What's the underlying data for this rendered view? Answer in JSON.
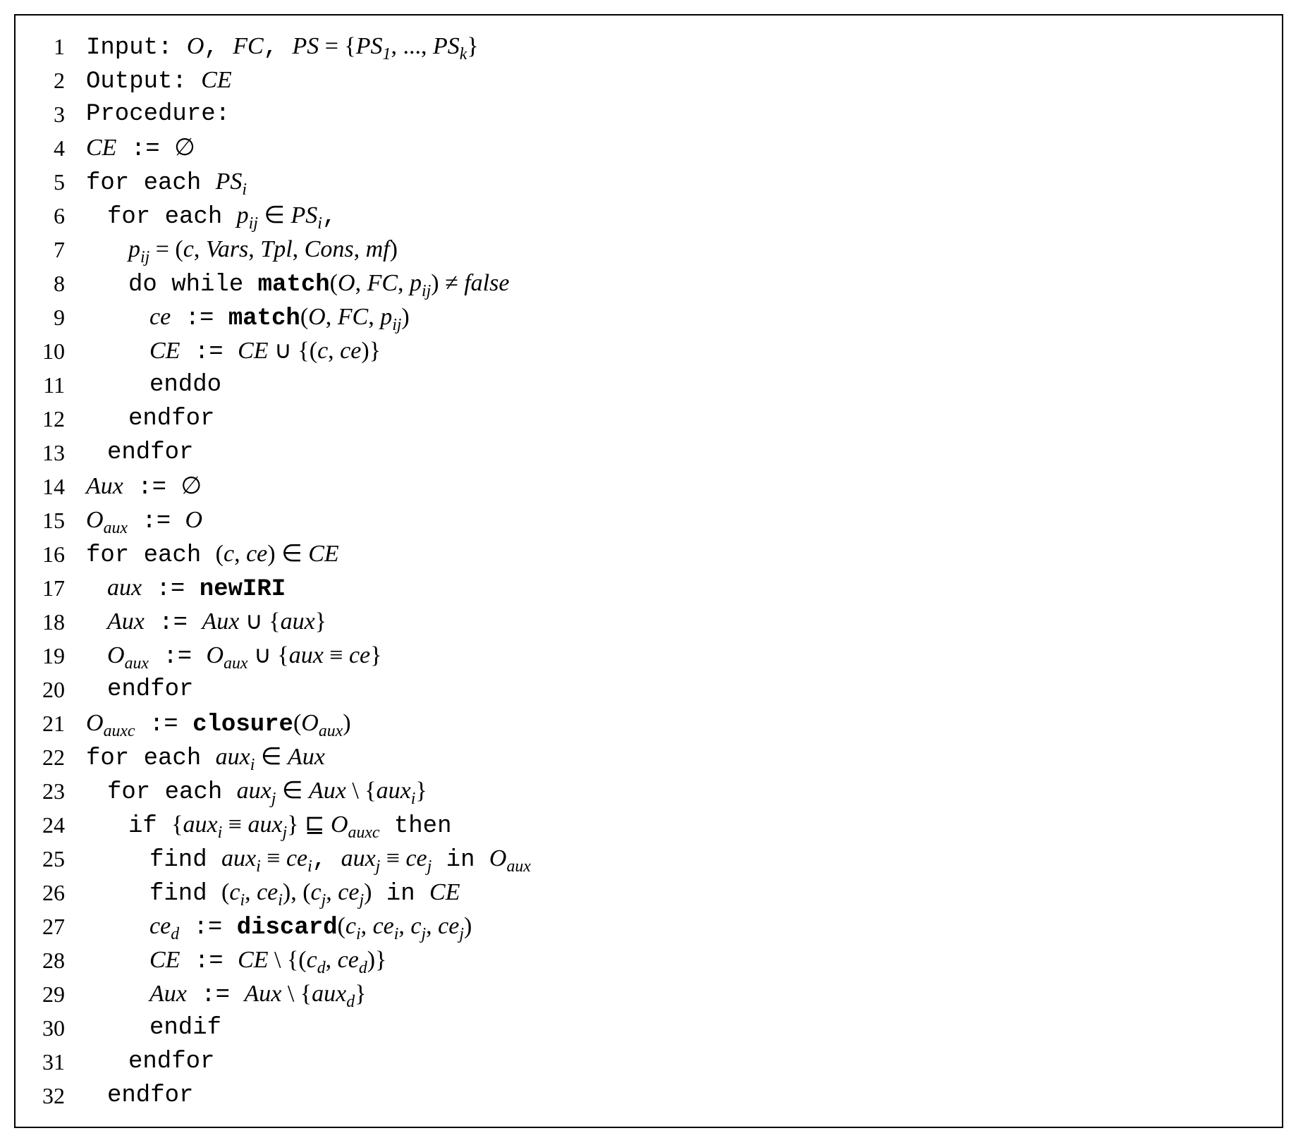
{
  "algorithm": {
    "lines": [
      {
        "n": "1",
        "indent": 0,
        "segs": [
          {
            "c": "tt",
            "t": "Input: "
          },
          {
            "c": "it",
            "t": "O"
          },
          {
            "c": "tt",
            "t": ", "
          },
          {
            "c": "it",
            "t": "FC"
          },
          {
            "c": "tt",
            "t": ", "
          },
          {
            "c": "it",
            "t": "PS"
          },
          {
            "c": "sym",
            "t": " = {"
          },
          {
            "c": "it",
            "t": "PS"
          },
          {
            "c": "sub",
            "t": "1"
          },
          {
            "c": "sym",
            "t": ", ..., "
          },
          {
            "c": "it",
            "t": "PS"
          },
          {
            "c": "sub",
            "t": "k"
          },
          {
            "c": "sym",
            "t": "}"
          }
        ]
      },
      {
        "n": "2",
        "indent": 0,
        "segs": [
          {
            "c": "tt",
            "t": "Output: "
          },
          {
            "c": "it",
            "t": "CE"
          }
        ]
      },
      {
        "n": "3",
        "indent": 0,
        "segs": [
          {
            "c": "tt",
            "t": "Procedure:"
          }
        ]
      },
      {
        "n": "4",
        "indent": 0,
        "segs": [
          {
            "c": "it",
            "t": "CE"
          },
          {
            "c": "tt",
            "t": " := "
          },
          {
            "c": "sym",
            "t": "∅"
          }
        ]
      },
      {
        "n": "5",
        "indent": 0,
        "segs": [
          {
            "c": "tt",
            "t": "for each "
          },
          {
            "c": "it",
            "t": "PS"
          },
          {
            "c": "sub",
            "t": "i"
          }
        ]
      },
      {
        "n": "6",
        "indent": 1,
        "segs": [
          {
            "c": "tt",
            "t": "for each "
          },
          {
            "c": "it",
            "t": "p"
          },
          {
            "c": "sub",
            "t": "ij"
          },
          {
            "c": "sym",
            "t": " ∈ "
          },
          {
            "c": "it",
            "t": "PS"
          },
          {
            "c": "sub",
            "t": "i"
          },
          {
            "c": "tt",
            "t": ","
          }
        ]
      },
      {
        "n": "7",
        "indent": 2,
        "segs": [
          {
            "c": "it",
            "t": "p"
          },
          {
            "c": "sub",
            "t": "ij"
          },
          {
            "c": "sym",
            "t": " = ("
          },
          {
            "c": "it",
            "t": "c"
          },
          {
            "c": "sym",
            "t": ", "
          },
          {
            "c": "it",
            "t": "Vars"
          },
          {
            "c": "sym",
            "t": ", "
          },
          {
            "c": "it",
            "t": "Tpl"
          },
          {
            "c": "sym",
            "t": ", "
          },
          {
            "c": "it",
            "t": "Cons"
          },
          {
            "c": "sym",
            "t": ", "
          },
          {
            "c": "it",
            "t": "mf"
          },
          {
            "c": "sym",
            "t": ")"
          }
        ]
      },
      {
        "n": "8",
        "indent": 2,
        "segs": [
          {
            "c": "tt",
            "t": "do while "
          },
          {
            "c": "bf",
            "t": "match"
          },
          {
            "c": "sym",
            "t": "("
          },
          {
            "c": "it",
            "t": "O"
          },
          {
            "c": "sym",
            "t": ", "
          },
          {
            "c": "it",
            "t": "FC"
          },
          {
            "c": "sym",
            "t": ", "
          },
          {
            "c": "it",
            "t": "p"
          },
          {
            "c": "sub",
            "t": "ij"
          },
          {
            "c": "sym",
            "t": ") ≠ "
          },
          {
            "c": "it",
            "t": "false"
          }
        ]
      },
      {
        "n": "9",
        "indent": 3,
        "segs": [
          {
            "c": "it",
            "t": "ce"
          },
          {
            "c": "tt",
            "t": " := "
          },
          {
            "c": "bf",
            "t": "match"
          },
          {
            "c": "sym",
            "t": "("
          },
          {
            "c": "it",
            "t": "O"
          },
          {
            "c": "sym",
            "t": ", "
          },
          {
            "c": "it",
            "t": "FC"
          },
          {
            "c": "sym",
            "t": ", "
          },
          {
            "c": "it",
            "t": "p"
          },
          {
            "c": "sub",
            "t": "ij"
          },
          {
            "c": "sym",
            "t": ")"
          }
        ]
      },
      {
        "n": "10",
        "indent": 3,
        "segs": [
          {
            "c": "it",
            "t": "CE"
          },
          {
            "c": "tt",
            "t": " := "
          },
          {
            "c": "it",
            "t": "CE"
          },
          {
            "c": "sym",
            "t": " ∪ {("
          },
          {
            "c": "it",
            "t": "c"
          },
          {
            "c": "sym",
            "t": ", "
          },
          {
            "c": "it",
            "t": "ce"
          },
          {
            "c": "sym",
            "t": ")}"
          }
        ]
      },
      {
        "n": "11",
        "indent": 3,
        "segs": [
          {
            "c": "tt",
            "t": "enddo"
          }
        ]
      },
      {
        "n": "12",
        "indent": 2,
        "segs": [
          {
            "c": "tt",
            "t": "endfor"
          }
        ]
      },
      {
        "n": "13",
        "indent": 1,
        "segs": [
          {
            "c": "tt",
            "t": "endfor"
          }
        ]
      },
      {
        "n": "14",
        "indent": 0,
        "segs": [
          {
            "c": "it",
            "t": "Aux"
          },
          {
            "c": "tt",
            "t": " := "
          },
          {
            "c": "sym",
            "t": "∅"
          }
        ]
      },
      {
        "n": "15",
        "indent": 0,
        "segs": [
          {
            "c": "it",
            "t": "O"
          },
          {
            "c": "sub",
            "t": "aux"
          },
          {
            "c": "tt",
            "t": " := "
          },
          {
            "c": "it",
            "t": "O"
          }
        ]
      },
      {
        "n": "16",
        "indent": 0,
        "segs": [
          {
            "c": "tt",
            "t": "for each "
          },
          {
            "c": "sym",
            "t": "("
          },
          {
            "c": "it",
            "t": "c"
          },
          {
            "c": "sym",
            "t": ", "
          },
          {
            "c": "it",
            "t": "ce"
          },
          {
            "c": "sym",
            "t": ") ∈ "
          },
          {
            "c": "it",
            "t": "CE"
          }
        ]
      },
      {
        "n": "17",
        "indent": 1,
        "segs": [
          {
            "c": "it",
            "t": "aux"
          },
          {
            "c": "tt",
            "t": " := "
          },
          {
            "c": "bf",
            "t": "newIRI"
          }
        ]
      },
      {
        "n": "18",
        "indent": 1,
        "segs": [
          {
            "c": "it",
            "t": "Aux"
          },
          {
            "c": "tt",
            "t": " := "
          },
          {
            "c": "it",
            "t": "Aux"
          },
          {
            "c": "sym",
            "t": " ∪ {"
          },
          {
            "c": "it",
            "t": "aux"
          },
          {
            "c": "sym",
            "t": "}"
          }
        ]
      },
      {
        "n": "19",
        "indent": 1,
        "segs": [
          {
            "c": "it",
            "t": "O"
          },
          {
            "c": "sub",
            "t": "aux"
          },
          {
            "c": "tt",
            "t": " := "
          },
          {
            "c": "it",
            "t": "O"
          },
          {
            "c": "sub",
            "t": "aux"
          },
          {
            "c": "sym",
            "t": " ∪ {"
          },
          {
            "c": "it",
            "t": "aux"
          },
          {
            "c": "sym",
            "t": " ≡ "
          },
          {
            "c": "it",
            "t": "ce"
          },
          {
            "c": "sym",
            "t": "}"
          }
        ]
      },
      {
        "n": "20",
        "indent": 1,
        "segs": [
          {
            "c": "tt",
            "t": "endfor"
          }
        ]
      },
      {
        "n": "21",
        "indent": 0,
        "segs": [
          {
            "c": "it",
            "t": "O"
          },
          {
            "c": "sub",
            "t": "auxc"
          },
          {
            "c": "tt",
            "t": " := "
          },
          {
            "c": "bf",
            "t": "closure"
          },
          {
            "c": "sym",
            "t": "("
          },
          {
            "c": "it",
            "t": "O"
          },
          {
            "c": "sub",
            "t": "aux"
          },
          {
            "c": "sym",
            "t": ")"
          }
        ]
      },
      {
        "n": "22",
        "indent": 0,
        "segs": [
          {
            "c": "tt",
            "t": "for each "
          },
          {
            "c": "it",
            "t": "aux"
          },
          {
            "c": "sub",
            "t": "i"
          },
          {
            "c": "sym",
            "t": " ∈ "
          },
          {
            "c": "it",
            "t": "Aux"
          }
        ]
      },
      {
        "n": "23",
        "indent": 1,
        "segs": [
          {
            "c": "tt",
            "t": "for each "
          },
          {
            "c": "it",
            "t": "aux"
          },
          {
            "c": "sub",
            "t": "j"
          },
          {
            "c": "sym",
            "t": " ∈ "
          },
          {
            "c": "it",
            "t": "Aux"
          },
          {
            "c": "sym",
            "t": " \\ {"
          },
          {
            "c": "it",
            "t": "aux"
          },
          {
            "c": "sub",
            "t": "i"
          },
          {
            "c": "sym",
            "t": "}"
          }
        ]
      },
      {
        "n": "24",
        "indent": 2,
        "segs": [
          {
            "c": "tt",
            "t": "if "
          },
          {
            "c": "sym",
            "t": "{"
          },
          {
            "c": "it",
            "t": "aux"
          },
          {
            "c": "sub",
            "t": "i"
          },
          {
            "c": "sym",
            "t": " ≡ "
          },
          {
            "c": "it",
            "t": "aux"
          },
          {
            "c": "sub",
            "t": "j"
          },
          {
            "c": "sym",
            "t": "} ⊑ "
          },
          {
            "c": "it",
            "t": "O"
          },
          {
            "c": "sub",
            "t": "auxc"
          },
          {
            "c": "tt",
            "t": " then"
          }
        ]
      },
      {
        "n": "25",
        "indent": 3,
        "segs": [
          {
            "c": "tt",
            "t": "find "
          },
          {
            "c": "it",
            "t": "aux"
          },
          {
            "c": "sub",
            "t": "i"
          },
          {
            "c": "sym",
            "t": " ≡ "
          },
          {
            "c": "it",
            "t": "ce"
          },
          {
            "c": "sub",
            "t": "i"
          },
          {
            "c": "tt",
            "t": ", "
          },
          {
            "c": "it",
            "t": "aux"
          },
          {
            "c": "sub",
            "t": "j"
          },
          {
            "c": "sym",
            "t": " ≡ "
          },
          {
            "c": "it",
            "t": "ce"
          },
          {
            "c": "sub",
            "t": "j"
          },
          {
            "c": "tt",
            "t": " in "
          },
          {
            "c": "it",
            "t": "O"
          },
          {
            "c": "sub",
            "t": "aux"
          }
        ]
      },
      {
        "n": "26",
        "indent": 3,
        "segs": [
          {
            "c": "tt",
            "t": "find "
          },
          {
            "c": "sym",
            "t": "("
          },
          {
            "c": "it",
            "t": "c"
          },
          {
            "c": "sub",
            "t": "i"
          },
          {
            "c": "sym",
            "t": ", "
          },
          {
            "c": "it",
            "t": "ce"
          },
          {
            "c": "sub",
            "t": "i"
          },
          {
            "c": "sym",
            "t": "), ("
          },
          {
            "c": "it",
            "t": "c"
          },
          {
            "c": "sub",
            "t": "j"
          },
          {
            "c": "sym",
            "t": ", "
          },
          {
            "c": "it",
            "t": "ce"
          },
          {
            "c": "sub",
            "t": "j"
          },
          {
            "c": "sym",
            "t": ")"
          },
          {
            "c": "tt",
            "t": " in "
          },
          {
            "c": "it",
            "t": "CE"
          }
        ]
      },
      {
        "n": "27",
        "indent": 3,
        "segs": [
          {
            "c": "it",
            "t": "ce"
          },
          {
            "c": "sub",
            "t": "d"
          },
          {
            "c": "tt",
            "t": " := "
          },
          {
            "c": "bf",
            "t": "discard"
          },
          {
            "c": "sym",
            "t": "("
          },
          {
            "c": "it",
            "t": "c"
          },
          {
            "c": "sub",
            "t": "i"
          },
          {
            "c": "sym",
            "t": ", "
          },
          {
            "c": "it",
            "t": "ce"
          },
          {
            "c": "sub",
            "t": "i"
          },
          {
            "c": "sym",
            "t": ", "
          },
          {
            "c": "it",
            "t": "c"
          },
          {
            "c": "sub",
            "t": "j"
          },
          {
            "c": "sym",
            "t": ", "
          },
          {
            "c": "it",
            "t": "ce"
          },
          {
            "c": "sub",
            "t": "j"
          },
          {
            "c": "sym",
            "t": ")"
          }
        ]
      },
      {
        "n": "28",
        "indent": 3,
        "segs": [
          {
            "c": "it",
            "t": "CE"
          },
          {
            "c": "tt",
            "t": " := "
          },
          {
            "c": "it",
            "t": "CE"
          },
          {
            "c": "sym",
            "t": " \\ {("
          },
          {
            "c": "it",
            "t": "c"
          },
          {
            "c": "sub",
            "t": "d"
          },
          {
            "c": "sym",
            "t": ", "
          },
          {
            "c": "it",
            "t": "ce"
          },
          {
            "c": "sub",
            "t": "d"
          },
          {
            "c": "sym",
            "t": ")}"
          }
        ]
      },
      {
        "n": "29",
        "indent": 3,
        "segs": [
          {
            "c": "it",
            "t": "Aux"
          },
          {
            "c": "tt",
            "t": " := "
          },
          {
            "c": "it",
            "t": "Aux"
          },
          {
            "c": "sym",
            "t": " \\ {"
          },
          {
            "c": "it",
            "t": "aux"
          },
          {
            "c": "sub",
            "t": "d"
          },
          {
            "c": "sym",
            "t": "}"
          }
        ]
      },
      {
        "n": "30",
        "indent": 3,
        "segs": [
          {
            "c": "tt",
            "t": "endif"
          }
        ]
      },
      {
        "n": "31",
        "indent": 2,
        "segs": [
          {
            "c": "tt",
            "t": "endfor"
          }
        ]
      },
      {
        "n": "32",
        "indent": 1,
        "segs": [
          {
            "c": "tt",
            "t": "endfor"
          }
        ]
      }
    ]
  }
}
